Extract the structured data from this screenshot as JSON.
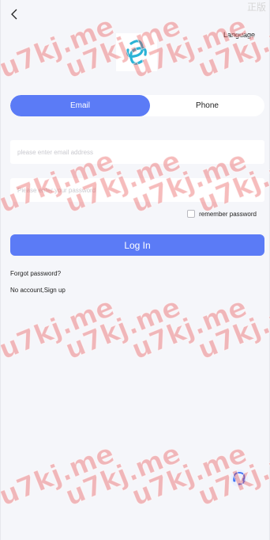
{
  "corner_text": "正版",
  "header": {
    "language_label": "Language"
  },
  "tabs": [
    {
      "label": "Email",
      "active": true
    },
    {
      "label": "Phone",
      "active": false
    }
  ],
  "form": {
    "email_placeholder": "please enter email address",
    "email_value": "",
    "password_placeholder": "Please enter your password",
    "password_value": "",
    "remember_label": "remember password",
    "remember_checked": false,
    "login_label": "Log In"
  },
  "links": {
    "forgot_label": "Forgot password?",
    "no_account_label": "No account,",
    "signup_label": "Sign up"
  },
  "watermark_text": "u7kj.me",
  "colors": {
    "accent": "#5b7bf6",
    "logo": "#2bb3d6",
    "watermark": "#e85050",
    "background": "#f5f6fa"
  },
  "icons": {
    "back": "chevron-left-icon",
    "logo": "interlocking-rings-logo",
    "support": "headset-icon"
  }
}
